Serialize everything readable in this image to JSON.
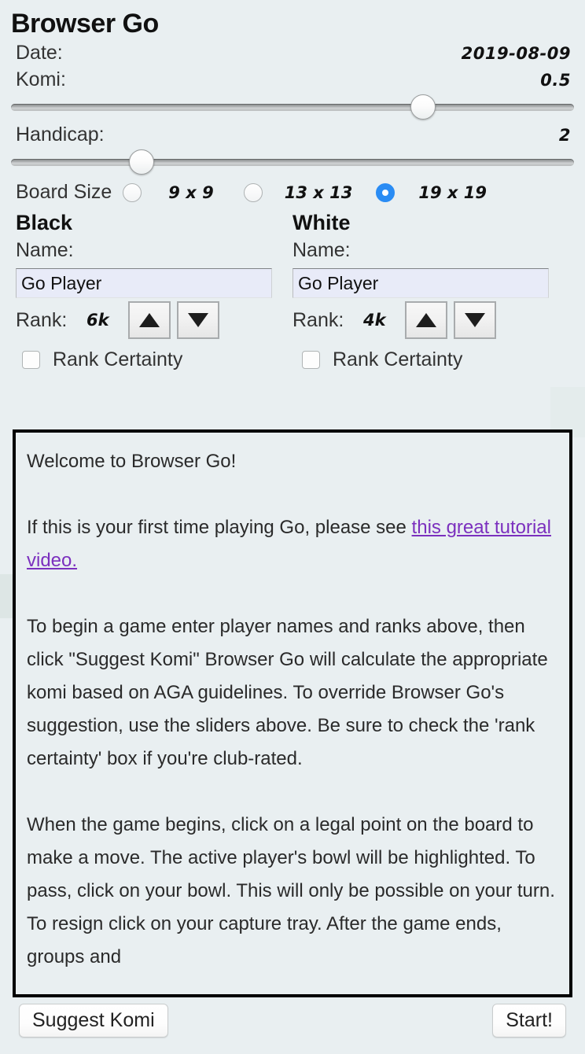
{
  "app": {
    "title": "Browser Go"
  },
  "settings": {
    "date_label": "Date:",
    "date_value": "2019-08-09",
    "komi_label": "Komi:",
    "komi_value": "0.5",
    "komi_slider_percent": 73,
    "handicap_label": "Handicap:",
    "handicap_value": "2",
    "handicap_slider_percent": 23,
    "board_size_label": "Board Size",
    "board_sizes": [
      {
        "label": "9 x 9",
        "selected": false
      },
      {
        "label": "13 x 13",
        "selected": false
      },
      {
        "label": "19 x 19",
        "selected": true
      }
    ]
  },
  "black": {
    "heading": "Black",
    "name_label": "Name:",
    "name_value": "Go Player",
    "rank_label": "Rank:",
    "rank_value": "6k",
    "rank_up_icon": "triangle-up-icon",
    "rank_down_icon": "triangle-down-icon",
    "certainty_label": "Rank Certainty",
    "certainty_checked": false
  },
  "white": {
    "heading": "White",
    "name_label": "Name:",
    "name_value": "Go Player",
    "rank_label": "Rank:",
    "rank_value": "4k",
    "rank_up_icon": "triangle-up-icon",
    "rank_down_icon": "triangle-down-icon",
    "certainty_label": "Rank Certainty",
    "certainty_checked": false
  },
  "info": {
    "greeting": "Welcome to Browser Go!",
    "intro_prefix": "If this is your first time playing Go, please see ",
    "intro_link": "this great tutorial video.",
    "paragraph_begin": "To begin a game enter player names and ranks above, then click \"Suggest Komi\" Browser Go will calculate the appropriate komi based on AGA guidelines. To override Browser Go's suggestion, use the sliders above. Be sure to check the 'rank certainty' box if you're club-rated.",
    "paragraph_play": "When the game begins, click on a legal point on the board to make a move. The active player's bowl will be highlighted. To pass, click on your bowl. This will only be possible on your turn. To resign click on your capture tray. After the game ends, groups and"
  },
  "footer": {
    "suggest_komi_label": "Suggest Komi",
    "start_label": "Start!"
  },
  "colors": {
    "background": "#e9eff1",
    "accent_radio": "#2a8cf4",
    "link": "#7b2fbe",
    "input_background": "#e8ebf8"
  }
}
